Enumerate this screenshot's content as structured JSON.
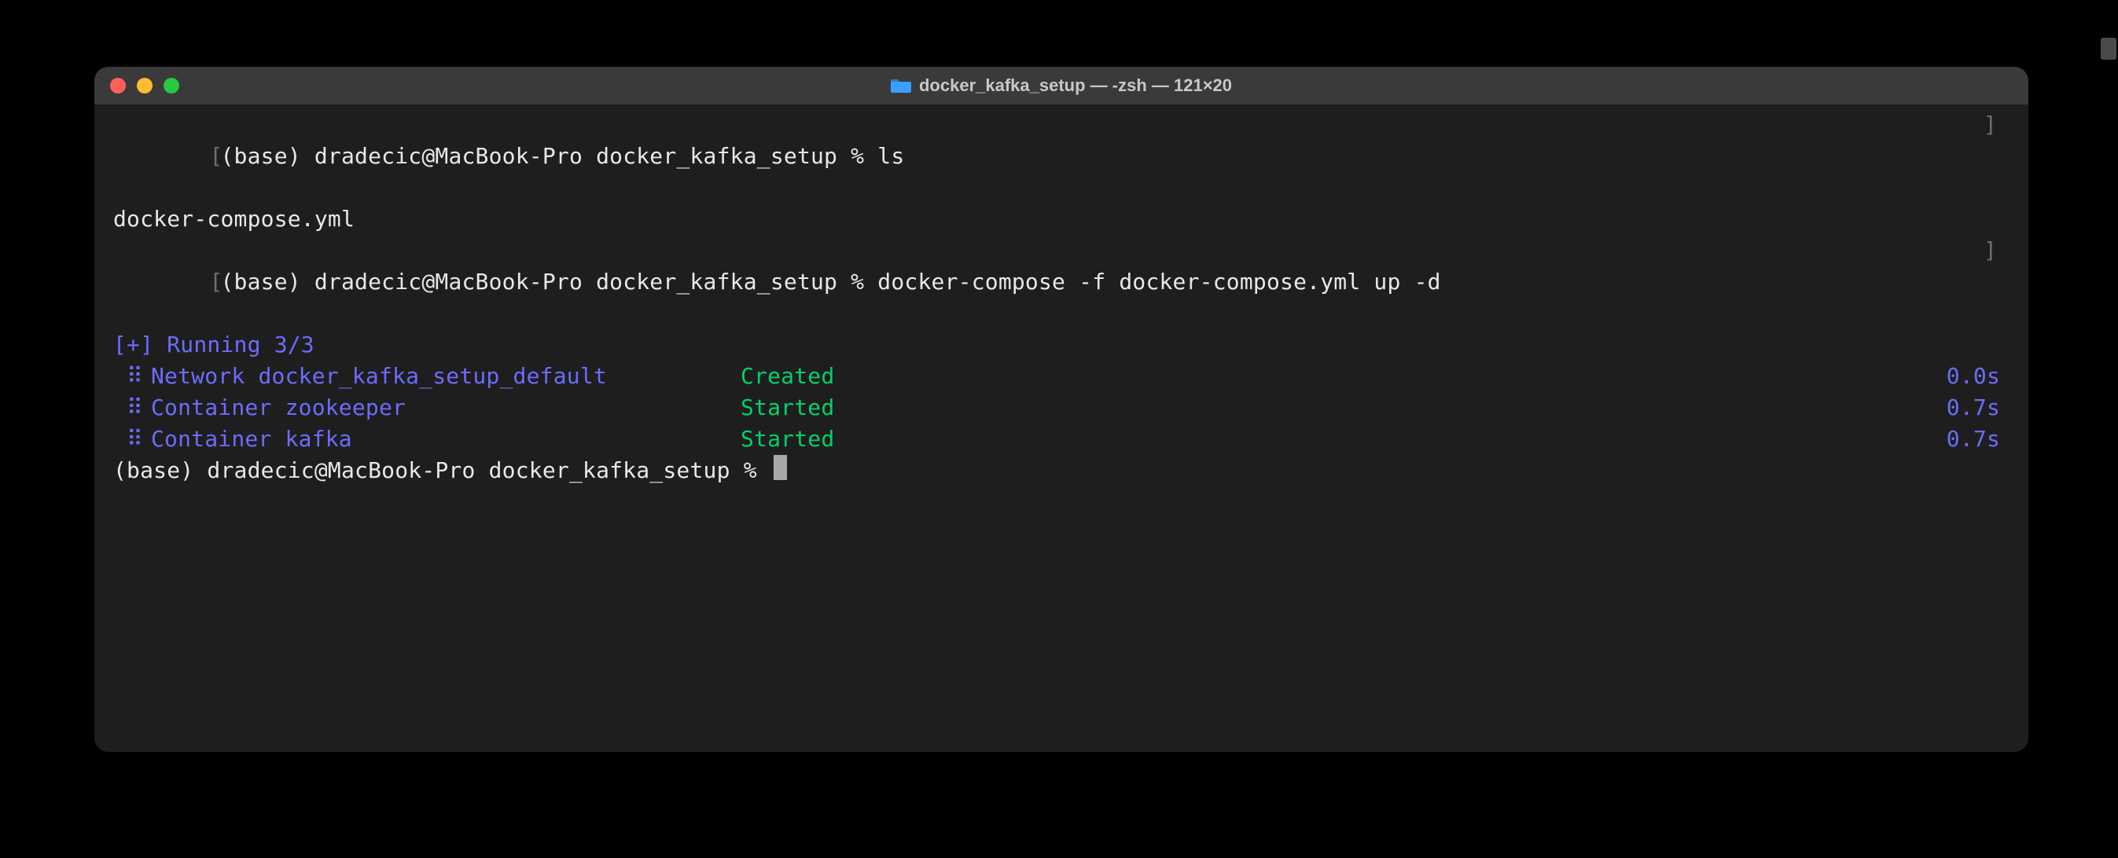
{
  "window": {
    "title": "docker_kafka_setup — -zsh — 121×20"
  },
  "terminal": {
    "line1_prompt": "(base) dradecic@MacBook-Pro docker_kafka_setup % ",
    "line1_cmd": "ls",
    "line2_output": "docker-compose.yml",
    "line3_prompt": "(base) dradecic@MacBook-Pro docker_kafka_setup % ",
    "line3_cmd": "docker-compose -f docker-compose.yml up -d",
    "running_header": "[+] Running 3/3",
    "status_glyph": "⠿",
    "rows": [
      {
        "label": "Network docker_kafka_setup_default",
        "status": "Created",
        "time": "0.0s"
      },
      {
        "label": "Container zookeeper",
        "status": "Started",
        "time": "0.7s"
      },
      {
        "label": "Container kafka",
        "status": "Started",
        "time": "0.7s"
      }
    ],
    "final_prompt": "(base) dradecic@MacBook-Pro docker_kafka_setup % "
  },
  "brackets": {
    "open": "[",
    "close": "]"
  }
}
